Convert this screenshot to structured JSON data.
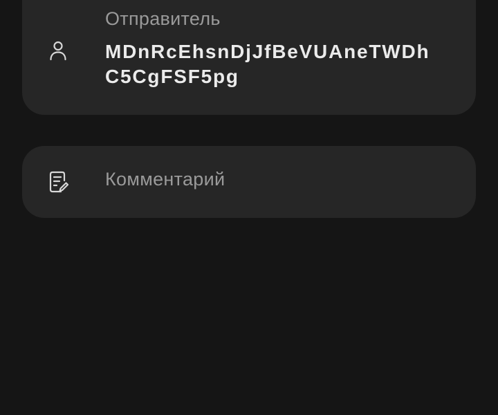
{
  "sender": {
    "label": "Отправитель",
    "address_line1": "MDnRcEhsnDjJfBeVUAneTWDh",
    "address_line2": "C5CgFSF5pg",
    "icon": "user-icon"
  },
  "comment": {
    "placeholder": "Комментарий",
    "icon": "note-edit-icon"
  },
  "colors": {
    "background": "#151515",
    "card": "#262626",
    "label": "#9a9a9a",
    "value": "#ebebeb"
  }
}
